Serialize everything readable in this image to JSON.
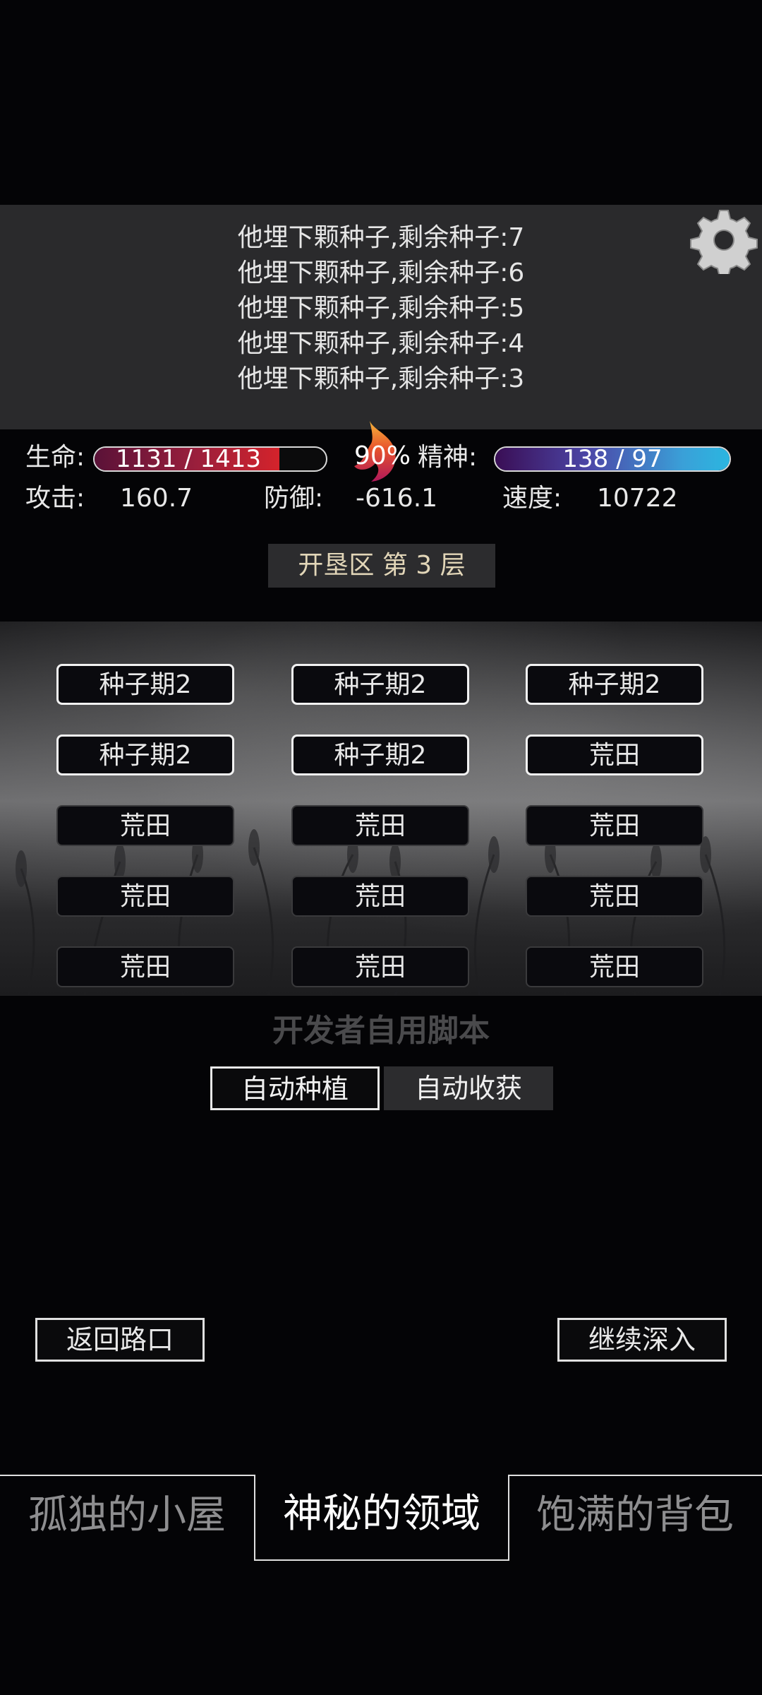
{
  "log": {
    "lines": [
      "他埋下颗种子,剩余种子:7",
      "他埋下颗种子,剩余种子:6",
      "他埋下颗种子,剩余种子:5",
      "他埋下颗种子,剩余种子:4",
      "他埋下颗种子,剩余种子:3"
    ]
  },
  "stats": {
    "hp_label": "生命:",
    "hp_text": "1131 / 1413",
    "hp_fraction": 0.8,
    "mood_percent": "90%",
    "sp_label": "精神:",
    "sp_text": "138 / 97",
    "sp_fraction": 1.0,
    "atk_label": "攻击:",
    "atk_value": "160.7",
    "def_label": "防御:",
    "def_value": "-616.1",
    "spd_label": "速度:",
    "spd_value": "10722"
  },
  "zone": {
    "title": "开垦区 第 3 层"
  },
  "field": {
    "plots": [
      [
        "种子期2",
        "种子期2",
        "种子期2"
      ],
      [
        "种子期2",
        "种子期2",
        "荒田"
      ],
      [
        "荒田",
        "荒田",
        "荒田"
      ],
      [
        "荒田",
        "荒田",
        "荒田"
      ],
      [
        "荒田",
        "荒田",
        "荒田"
      ]
    ]
  },
  "script": {
    "title": "开发者自用脚本",
    "auto_plant": "自动种植",
    "auto_harvest": "自动收获"
  },
  "nav": {
    "back": "返回路口",
    "continue": "继续深入"
  },
  "tabs": [
    {
      "label": "孤独的小屋"
    },
    {
      "label": "神秘的领域"
    },
    {
      "label": "饱满的背包"
    }
  ],
  "colors": {
    "hp_bar": "#d4232b",
    "sp_bar": "#2bb6e0",
    "zone_title_text": "#e2d6b8"
  }
}
